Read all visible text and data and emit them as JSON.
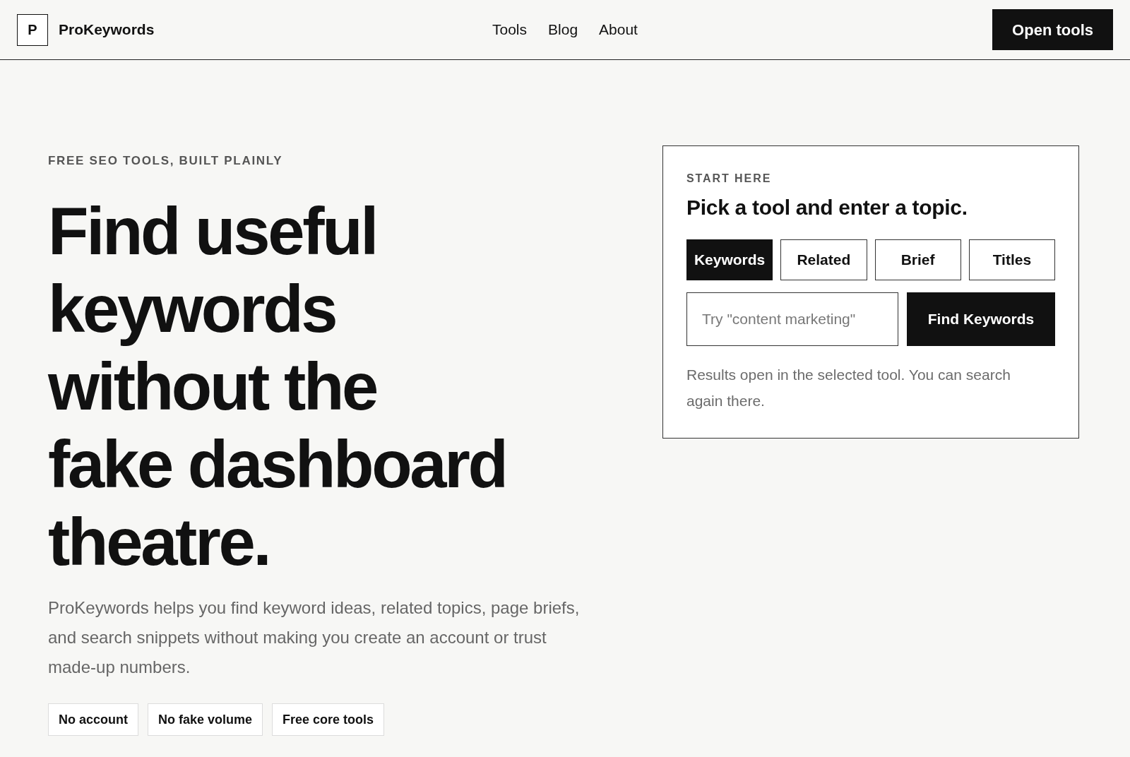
{
  "header": {
    "logo": {
      "mark": "P",
      "name": "ProKeywords"
    },
    "nav": [
      {
        "label": "Tools"
      },
      {
        "label": "Blog"
      },
      {
        "label": "About"
      }
    ],
    "cta": "Open tools"
  },
  "hero": {
    "eyebrow": "FREE SEO TOOLS, BUILT PLAINLY",
    "headline_lines": [
      "Find useful",
      "keywords",
      "without the",
      "fake dashboard",
      "theatre."
    ],
    "description": "ProKeywords helps you find keyword ideas, related topics, page briefs, and search snippets without making you create an account or trust made-up numbers.",
    "badges": [
      "No account",
      "No fake volume",
      "Free core tools"
    ]
  },
  "tool_card": {
    "eyebrow": "START HERE",
    "title": "Pick a tool and enter a topic.",
    "tabs": [
      {
        "label": "Keywords",
        "selected": true
      },
      {
        "label": "Related",
        "selected": false
      },
      {
        "label": "Brief",
        "selected": false
      },
      {
        "label": "Titles",
        "selected": false
      }
    ],
    "search": {
      "placeholder": "Try \"content marketing\""
    },
    "submit": "Find Keywords",
    "note": "Results open in the selected tool. You can search again there."
  }
}
